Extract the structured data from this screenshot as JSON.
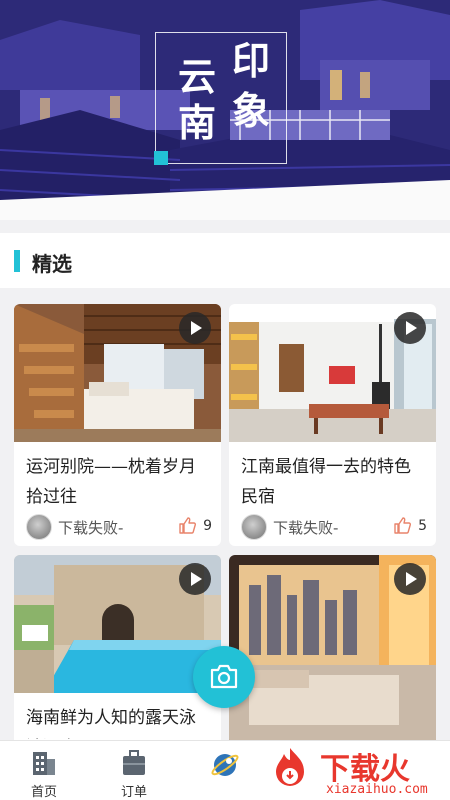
{
  "banner": {
    "title_chars": [
      "云",
      "南",
      "印",
      "象"
    ]
  },
  "section": {
    "title": "精选"
  },
  "cards": [
    {
      "title": "运河别院——枕着岁月拾过往",
      "author": "下载失败-",
      "likes": "9"
    },
    {
      "title": "江南最值得一去的特色民宿",
      "author": "下载失败-",
      "likes": "5"
    },
    {
      "title": "海南鲜为人知的露天泳池酒店",
      "author": "",
      "likes": ""
    },
    {
      "title": "",
      "author": "",
      "likes": ""
    }
  ],
  "tabs": [
    {
      "label": "首页",
      "icon": "building-icon"
    },
    {
      "label": "订单",
      "icon": "briefcase-icon"
    },
    {
      "label": "",
      "icon": "planet-icon"
    }
  ],
  "fab": {
    "icon": "camera-icon"
  },
  "watermark": {
    "brand": "下载火",
    "domain": "xiazaihuo.com"
  },
  "colors": {
    "accent": "#22c1d6",
    "watermark": "#e8372d"
  }
}
